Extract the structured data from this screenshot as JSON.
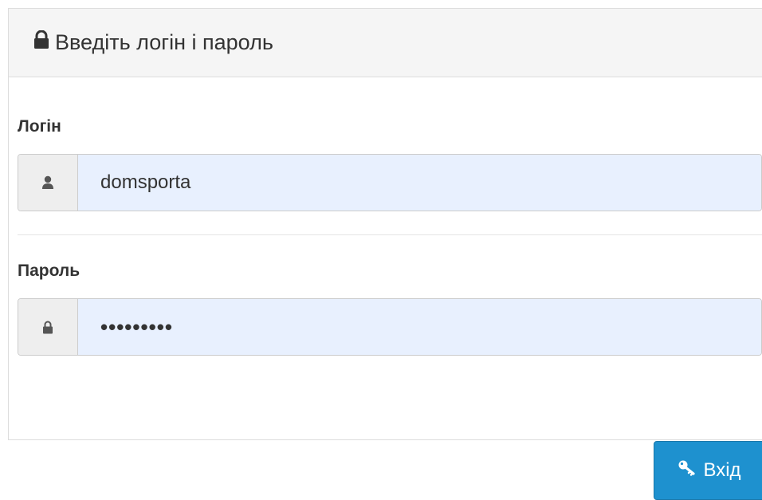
{
  "header": {
    "title": "Введіть логін і пароль",
    "icon": "lock-icon"
  },
  "login": {
    "label": "Логін",
    "value": "domsporta",
    "icon": "user-icon"
  },
  "password": {
    "label": "Пароль",
    "value": "•••••••••",
    "icon": "lock-icon"
  },
  "submit": {
    "label": "Вхід",
    "icon": "key-icon"
  },
  "colors": {
    "button": "#1e91cf",
    "input_bg": "#e8f0fe",
    "addon_bg": "#eeeeee",
    "heading_bg": "#f5f5f5"
  }
}
